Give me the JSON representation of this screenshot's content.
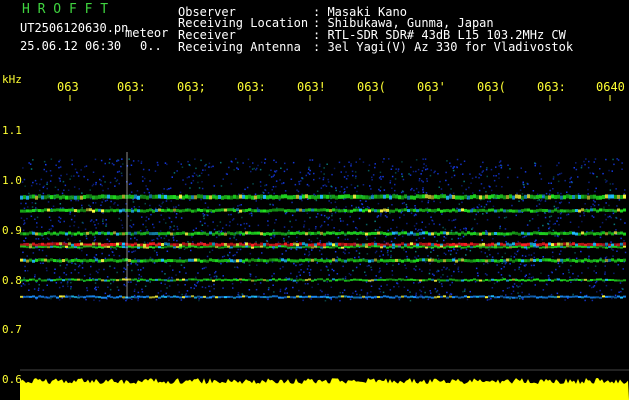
{
  "header": {
    "program": "H R O F F T",
    "filename": "UT2506120630.pn",
    "mode": "meteor",
    "datetime": "25.06.12 06:30",
    "count": "0..",
    "fields": [
      {
        "label": "Observer",
        "value": ": Masaki Kano"
      },
      {
        "label": "Receiving Location",
        "value": ": Shibukawa, Gunma, Japan"
      },
      {
        "label": "Receiver",
        "value": ": RTL-SDR SDR# 43dB L15 103.2MHz CW"
      },
      {
        "label": "Receiving Antenna",
        "value": ": 3el Yagi(V) Az 330 for Vladivostok"
      }
    ]
  },
  "axis": {
    "unit": "kHz",
    "time_ticks": [
      "063",
      "063:",
      "063;",
      "063:",
      "063!",
      "063(",
      "063'",
      "063(",
      "063:",
      "0640"
    ],
    "freq_ticks": [
      "1.1",
      "1.0",
      "0.9",
      "0.8",
      "0.7",
      "0.6"
    ]
  },
  "colors": {
    "background": "#000000",
    "header_text": "#ffffff",
    "title_green": "#3fd43f",
    "tick_yellow": "#ffff33",
    "signal_red": "#ff2020",
    "signal_green": "#20e020",
    "noise_blue": "#1840ff",
    "bottom_bar_yellow": "#ffff00"
  }
}
